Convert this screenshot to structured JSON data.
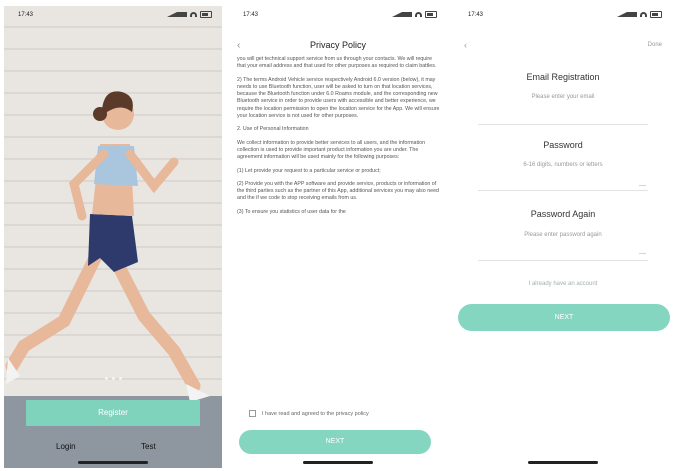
{
  "status": {
    "time": "17:43"
  },
  "screen1": {
    "register_label": "Register",
    "login_label": "Login",
    "test_label": "Test"
  },
  "screen2": {
    "title": "Privacy Policy",
    "paragraphs": [
      "you will get technical support service from us through your contacts. We will require that your email address and that used for other purposes as required to claim battles.",
      "2) The terms Android Vehicle service respectively Android 6.0 version (below), it may needs to use Bluetooth function, user will be asked to turn on that location services, because the Bluetooth function under 6.0 Roams module, and the corresponding new Bluetooth service in order to provide users with accessible and better experience, we require the location permission to open the location service for the App. We will ensure your location service is not used for other purposes.",
      "2. Use of Personal Information",
      "We collect information to provide better services to all users, and the information collection is used to provide important product information you are under. The agreement information will be used mainly for the following purposes:",
      "(1) Let provide your request to a particular service or product;",
      "(2) Provide you with the APP software and provide service, products or information of the third parties such as the partner of this App, additional services you may also need and the if we code to stop receiving emails from us.",
      "(3) To ensure you statistics of user data for the"
    ],
    "agree_text": "I have read and agreed to the privacy policy",
    "next_label": "NEXT"
  },
  "screen3": {
    "back_icon": "back-icon",
    "done_label": "Done",
    "email_label": "Email Registration",
    "email_placeholder": "Please enter your email",
    "password_label": "Password",
    "password_placeholder": "6-16 digits, numbers or letters",
    "password_again_label": "Password Again",
    "password_again_placeholder": "Please enter password again",
    "link_text": "I already have an account",
    "next_label": "NEXT"
  },
  "colors": {
    "accent": "#84d6c1"
  }
}
